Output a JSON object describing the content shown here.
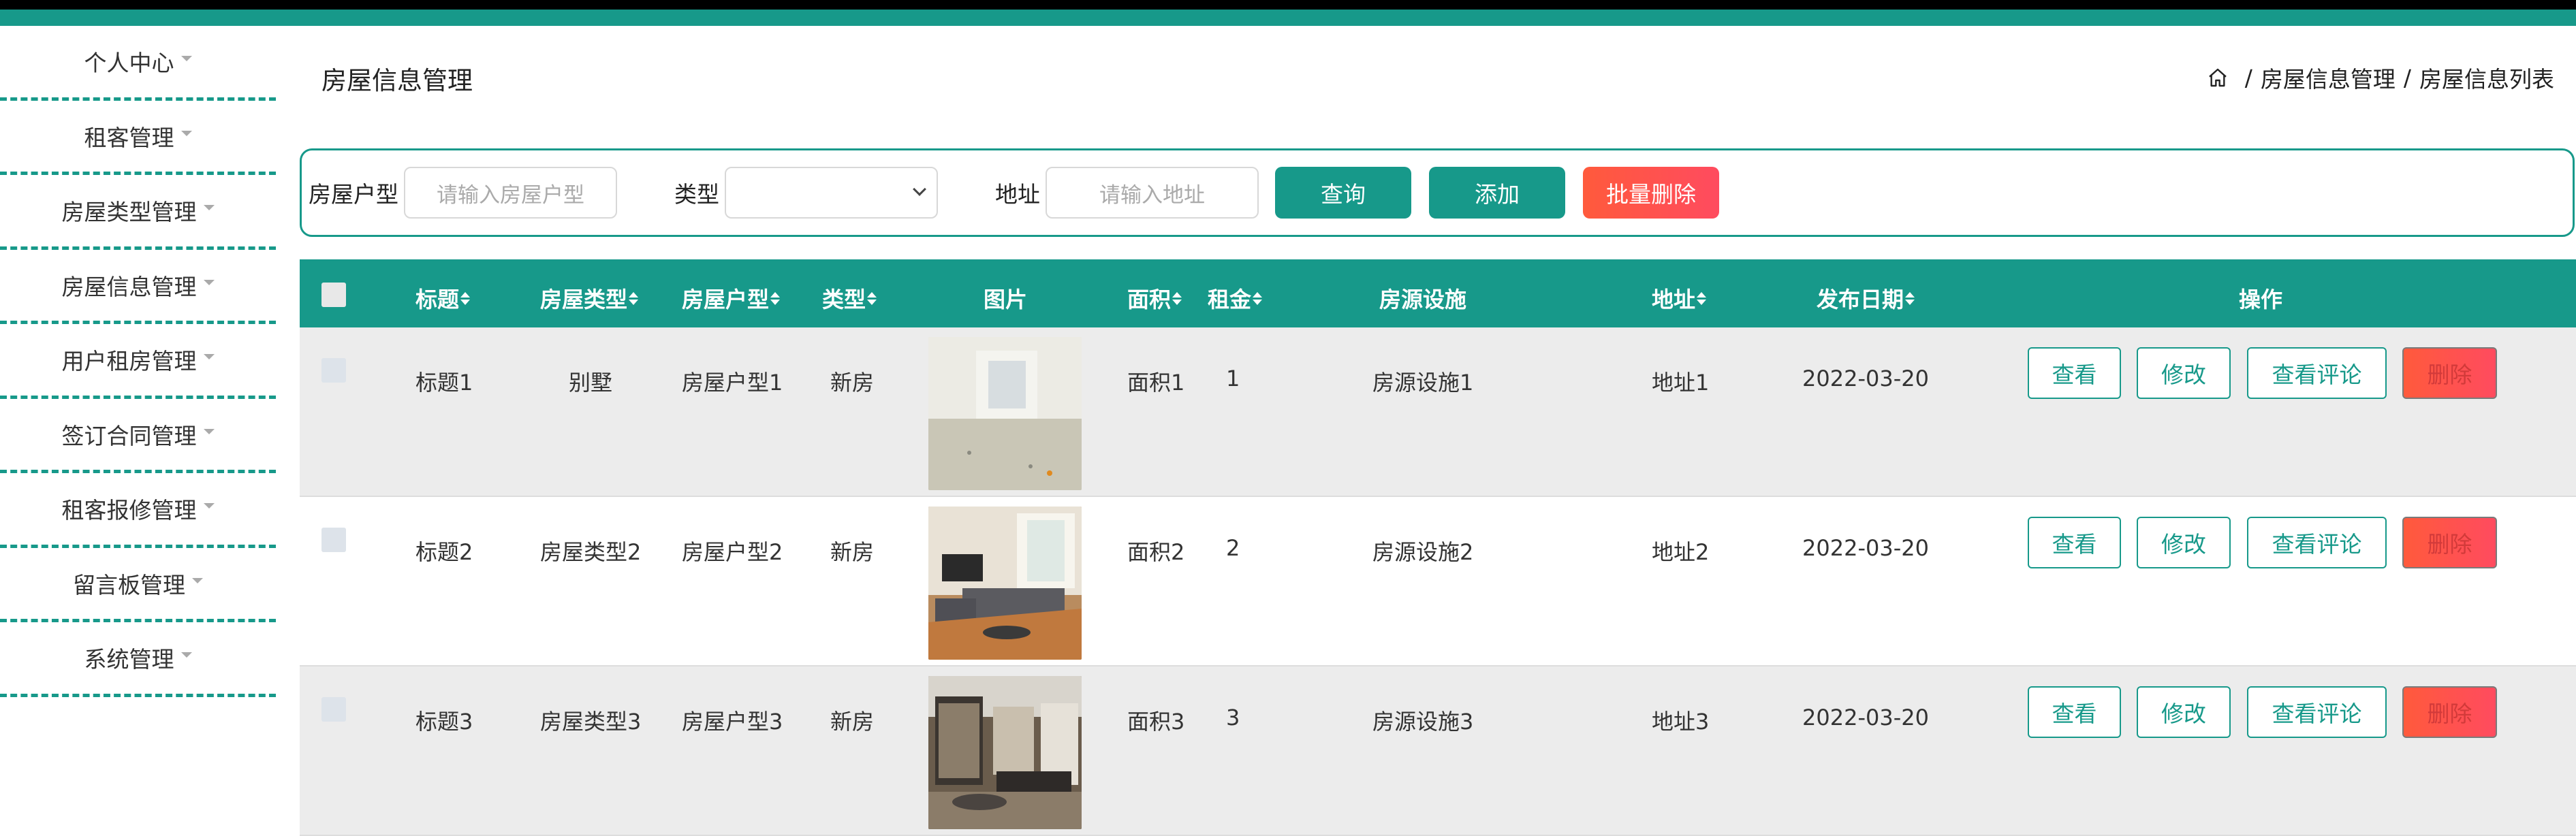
{
  "sidebar": {
    "items": [
      {
        "label": "个人中心"
      },
      {
        "label": "租客管理"
      },
      {
        "label": "房屋类型管理"
      },
      {
        "label": "房屋信息管理"
      },
      {
        "label": "用户租房管理"
      },
      {
        "label": "签订合同管理"
      },
      {
        "label": "租客报修管理"
      },
      {
        "label": "留言板管理"
      },
      {
        "label": "系统管理"
      }
    ]
  },
  "header": {
    "title": "房屋信息管理",
    "breadcrumb": [
      "房屋信息管理",
      "房屋信息列表"
    ],
    "breadcrumb_sep": "/"
  },
  "search": {
    "huxing_label": "房屋户型",
    "huxing_placeholder": "请输入房屋户型",
    "type_label": "类型",
    "type_value": "",
    "address_label": "地址",
    "address_placeholder": "请输入地址",
    "query_btn": "查询",
    "add_btn": "添加",
    "batch_delete_btn": "批量删除"
  },
  "table": {
    "headers": {
      "title": "标题",
      "house_type": "房屋类型",
      "huxing": "房屋户型",
      "kind": "类型",
      "image": "图片",
      "area": "面积",
      "rent": "租金",
      "facilities": "房源设施",
      "address": "地址",
      "date": "发布日期",
      "actions": "操作"
    },
    "rows": [
      {
        "title": "标题1",
        "house_type": "别墅",
        "huxing": "房屋户型1",
        "kind": "新房",
        "image": "empty-room-photo",
        "area": "面积1",
        "rent": "1",
        "facilities": "房源设施1",
        "address": "地址1",
        "date": "2022-03-20"
      },
      {
        "title": "标题2",
        "house_type": "房屋类型2",
        "huxing": "房屋户型2",
        "kind": "新房",
        "image": "living-room-photo",
        "area": "面积2",
        "rent": "2",
        "facilities": "房源设施2",
        "address": "地址2",
        "date": "2022-03-20"
      },
      {
        "title": "标题3",
        "house_type": "房屋类型3",
        "huxing": "房屋户型3",
        "kind": "新房",
        "image": "bedroom-photo",
        "area": "面积3",
        "rent": "3",
        "facilities": "房源设施3",
        "address": "地址3",
        "date": "2022-03-20"
      }
    ],
    "action_labels": {
      "view": "查看",
      "edit": "修改",
      "view_comments": "查看评论",
      "delete": "删除"
    }
  },
  "colors": {
    "primary": "#17998a",
    "danger": "#ff4b5f"
  }
}
